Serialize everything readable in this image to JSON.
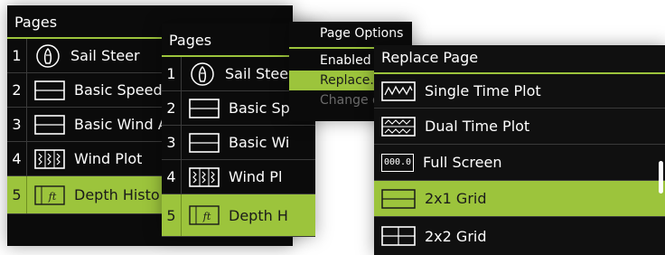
{
  "pages_panel_1": {
    "title": "Pages",
    "items": [
      {
        "num": "1",
        "label": "Sail Steer",
        "icon": "sail-steer-icon"
      },
      {
        "num": "2",
        "label": "Basic Speed",
        "icon": "single-pane-icon"
      },
      {
        "num": "3",
        "label": "Basic Wind A",
        "icon": "single-pane-icon"
      },
      {
        "num": "4",
        "label": "Wind Plot",
        "icon": "wind-plot-icon"
      },
      {
        "num": "5",
        "label": "Depth Histo",
        "icon": "depth-history-icon"
      }
    ],
    "selected_index": 4
  },
  "pages_panel_2": {
    "title": "Pages",
    "items": [
      {
        "num": "1",
        "label": "Sail Stee",
        "icon": "sail-steer-icon"
      },
      {
        "num": "2",
        "label": "Basic Sp",
        "icon": "single-pane-icon"
      },
      {
        "num": "3",
        "label": "Basic Wi",
        "icon": "single-pane-icon"
      },
      {
        "num": "4",
        "label": "Wind Pl",
        "icon": "wind-plot-icon"
      },
      {
        "num": "5",
        "label": "Depth H",
        "icon": "depth-history-icon"
      }
    ],
    "selected_index": 4
  },
  "page_options": {
    "title": "Page Options",
    "items": [
      {
        "label": "Enabled",
        "state": "normal"
      },
      {
        "label": "Replace...",
        "state": "selected"
      },
      {
        "label": "Change d",
        "state": "disabled"
      }
    ]
  },
  "replace_page": {
    "title": "Replace Page",
    "items": [
      {
        "label": "Single Time Plot",
        "icon": "single-time-plot-icon"
      },
      {
        "label": "Dual Time Plot",
        "icon": "dual-time-plot-icon"
      },
      {
        "label": "Full Screen",
        "icon": "full-screen-icon",
        "icon_text": "000.0"
      },
      {
        "label": "2x1 Grid",
        "icon": "grid-2x1-icon"
      },
      {
        "label": "2x2 Grid",
        "icon": "grid-2x2-icon"
      }
    ],
    "selected_index": 3
  },
  "colors": {
    "accent": "#9cc43c",
    "panel_bg": "#0b0b0b",
    "text": "#ffffff"
  }
}
